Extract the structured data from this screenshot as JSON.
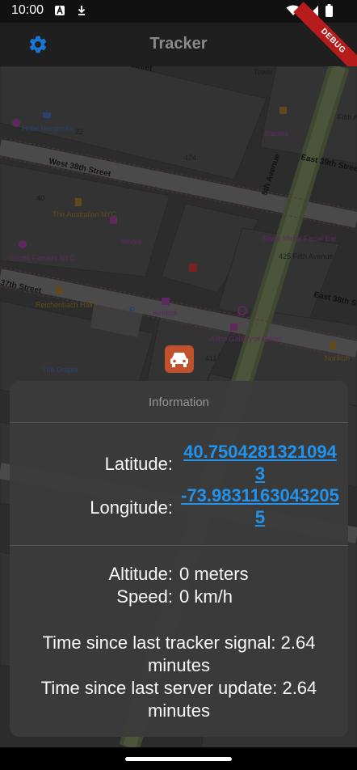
{
  "status_bar": {
    "time": "10:00"
  },
  "app_bar": {
    "title": "Tracker",
    "debug_label": "DEBUG"
  },
  "map": {
    "streets": [
      "West 38th Street",
      "37th Street",
      "5th Avenue",
      "East 39th Street",
      "East 38th Street",
      "Street"
    ],
    "places": [
      "Hotel Hendricks",
      "The Australian NYC",
      "élevée",
      "Scotts Flowers NYC",
      "Reichenbach Hall",
      "Reebok",
      "The Draper",
      "Silver Mirror Facial Bar",
      "425 Fifth Avenue",
      "Astro Gallery of Gems",
      "Staples",
      "Tower",
      "Norikoh",
      "Fifth Avenue",
      "411"
    ],
    "house_numbers": [
      "424",
      "40",
      "22"
    ],
    "marker_icon": "car-icon"
  },
  "info": {
    "title": "Information",
    "latitude_label": "Latitude:",
    "latitude_value": "40.75042813210943",
    "longitude_label": "Longitude:",
    "longitude_value": "-73.98311630432055",
    "altitude_label": "Altitude:",
    "altitude_value": "0 meters",
    "speed_label": "Speed:",
    "speed_value": "0 km/h",
    "tracker_signal_line1": "Time since last tracker signal: 2.64",
    "tracker_signal_line2": "minutes",
    "server_update_line1": "Time since last server update: 2.64",
    "server_update_line2": "minutes"
  },
  "colors": {
    "accent": "#2196f3",
    "marker": "#c1502c",
    "sheet": "#3b3b3b",
    "debug": "#b71c1c"
  }
}
